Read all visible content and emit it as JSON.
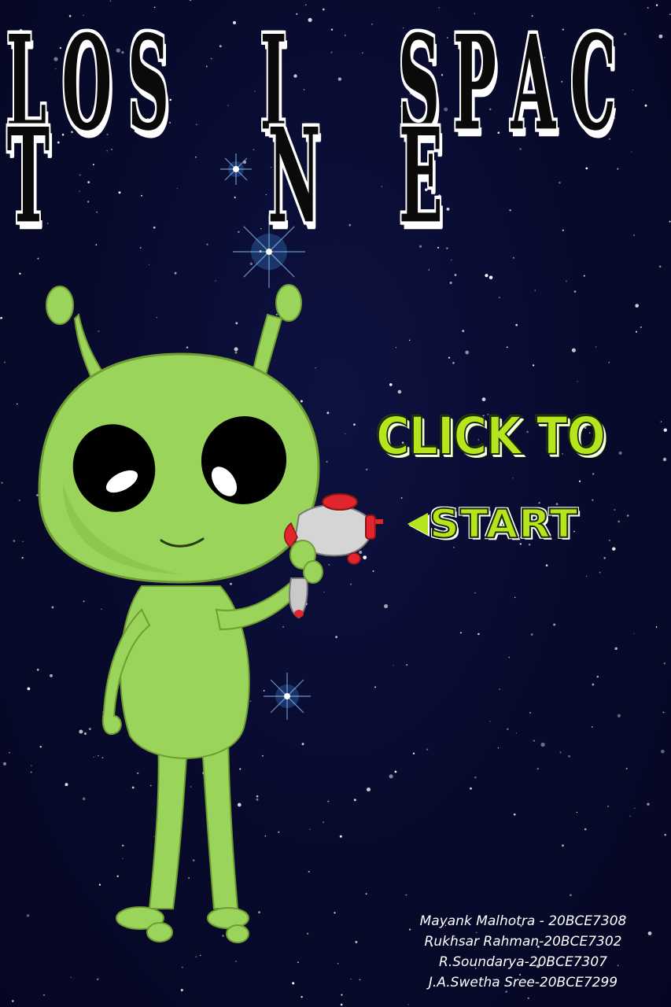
{
  "title": {
    "words": [
      "LOST",
      "IN",
      "SPACE"
    ]
  },
  "menu": {
    "prompt": "CLICK TO",
    "start_label": "START",
    "start_arrow_icon": "left-arrow-icon"
  },
  "credits": [
    "Mayank Malhotra - 20BCE7308",
    "Rukhsar Rahman-20BCE7302",
    "R.Soundarya-20BCE7307",
    "J.A.Swetha Sree-20BCE7299"
  ],
  "colors": {
    "background": "#07092a",
    "alien_green": "#9bd45a",
    "accent_green": "#b5e61d",
    "title_fill": "#0a0a0a",
    "title_outline": "#ffffff",
    "blaster_red": "#e0262c"
  }
}
